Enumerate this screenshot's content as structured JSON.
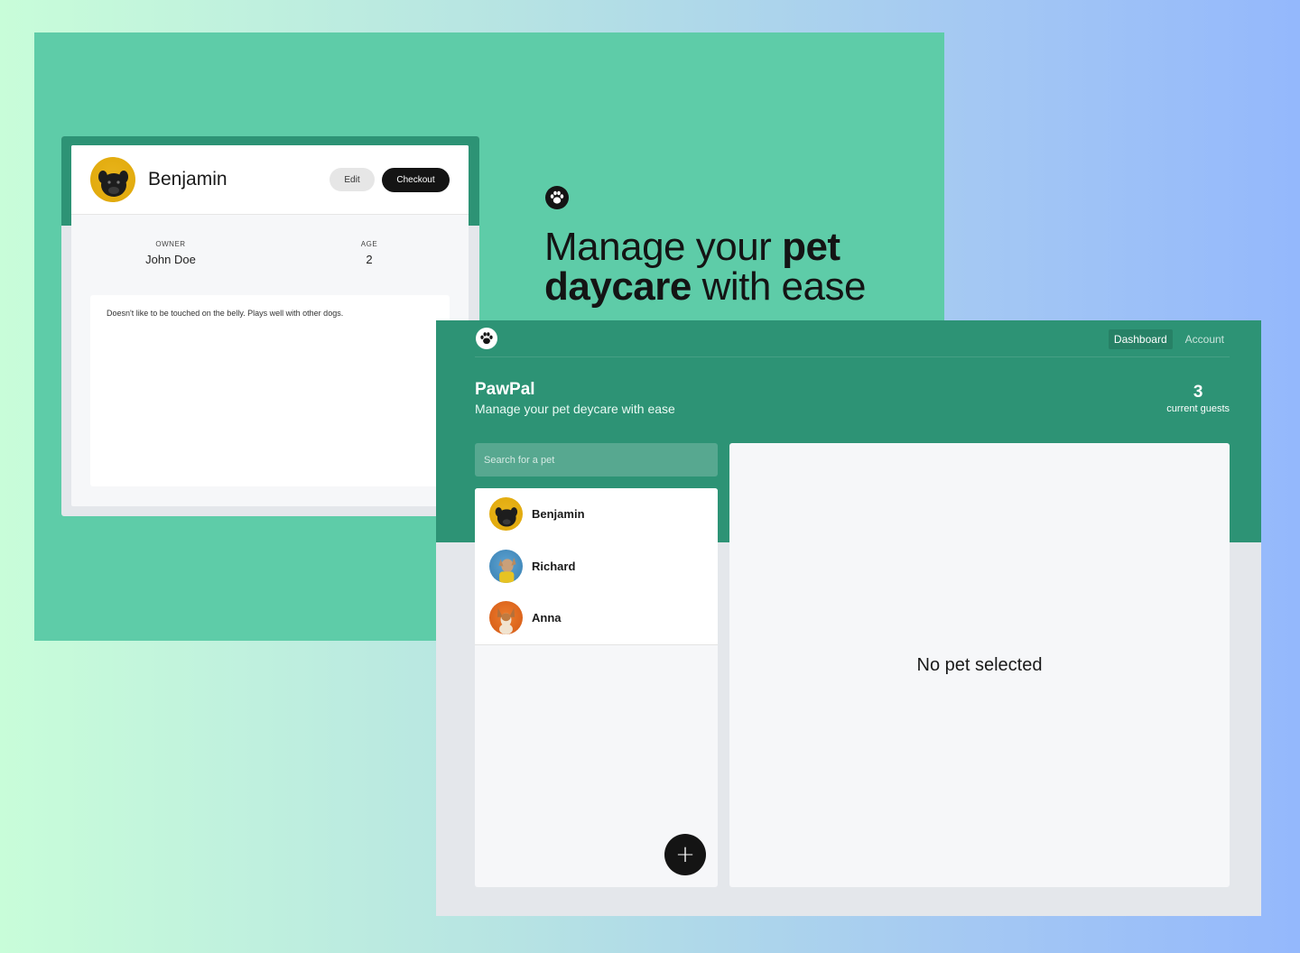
{
  "detail_mock": {
    "pet_name": "Benjamin",
    "edit_label": "Edit",
    "checkout_label": "Checkout",
    "owner_label": "OWNER",
    "owner_value": "John Doe",
    "age_label": "AGE",
    "age_value": "2",
    "notes": "Doesn't like to be touched on the belly. Plays well with other dogs."
  },
  "hero": {
    "title_regular_1": "Manage your ",
    "title_bold_1": "pet",
    "title_bold_2": "daycare",
    "title_regular_2": " with ease",
    "icon": "paw-icon"
  },
  "app": {
    "nav": {
      "logo_icon": "paw-icon",
      "links": [
        {
          "label": "Dashboard",
          "active": true
        },
        {
          "label": "Account",
          "active": false
        }
      ]
    },
    "brand_title": "PawPal",
    "brand_subtitle": "Manage your pet deycare with ease",
    "stat_value": "3",
    "stat_label": "current guests",
    "search_placeholder": "Search for a pet",
    "pets": [
      {
        "name": "Benjamin"
      },
      {
        "name": "Richard"
      },
      {
        "name": "Anna"
      }
    ],
    "add_button_icon": "plus-icon",
    "empty_state": "No pet selected"
  },
  "colors": {
    "hero_bg": "#5ecca8",
    "primary_green": "#2d9375",
    "dark": "#141414",
    "panel_bg": "#f6f7f9"
  }
}
